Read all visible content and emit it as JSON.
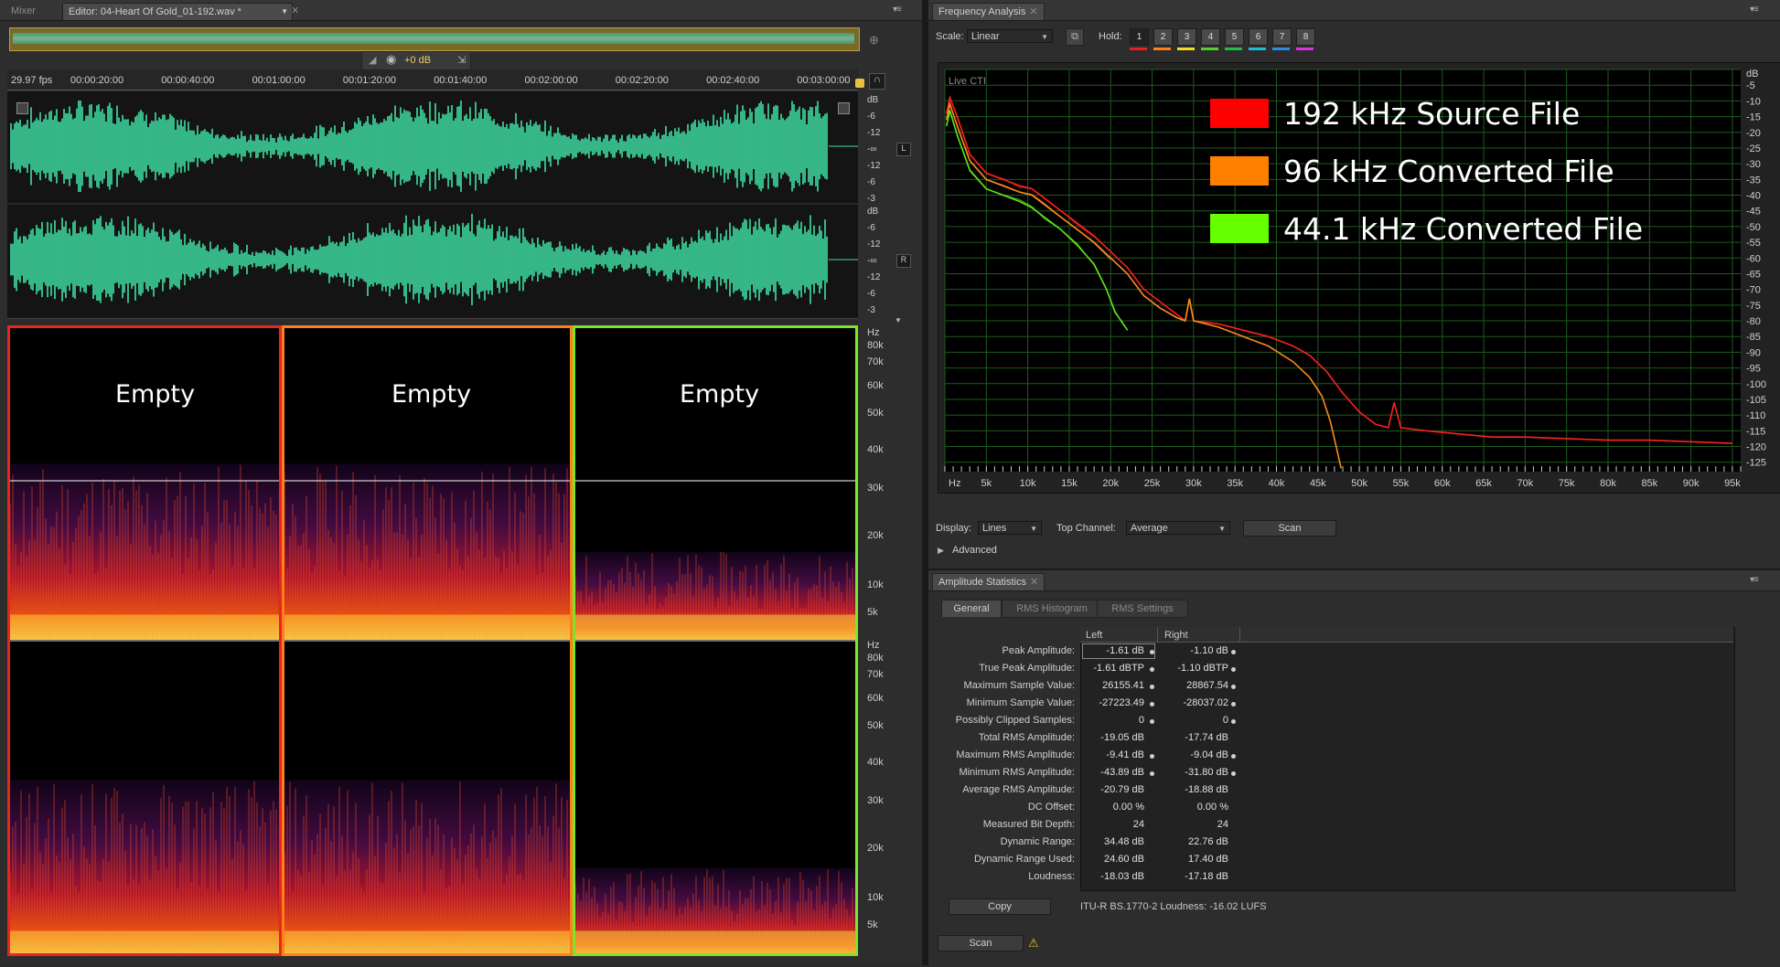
{
  "editor_panel": {
    "tabs": [
      {
        "label": "Mixer",
        "active": false
      },
      {
        "label": "Editor: 04-Heart Of Gold_01-192.wav *",
        "active": true
      }
    ],
    "volume_label": "+0 dB",
    "fps": "29.97 fps",
    "time_ruler": [
      "00:00:20:00",
      "00:00:40:00",
      "00:01:00:00",
      "00:01:20:00",
      "00:01:40:00",
      "00:02:00:00",
      "00:02:20:00",
      "00:02:40:00",
      "00:03:00:00"
    ],
    "db_scale_top": [
      "dB",
      "-6",
      "-12",
      "-∞",
      "-12",
      "-6",
      "-3"
    ],
    "db_scale_bottom": [
      "dB",
      "-6",
      "-12",
      "-∞",
      "-12",
      "-6",
      "-3"
    ],
    "channel_left": "L",
    "channel_right": "R",
    "hz_scale_top": [
      "Hz",
      "80k",
      "70k",
      "60k",
      "50k",
      "40k",
      "30k",
      "20k",
      "10k",
      "5k"
    ],
    "hz_scale_bottom": [
      "Hz",
      "80k",
      "70k",
      "60k",
      "50k",
      "40k",
      "30k",
      "20k",
      "10k",
      "5k"
    ],
    "empty_labels": [
      "Empty",
      "Empty",
      "Empty"
    ],
    "waveform_color": "#3fe0a6",
    "section_colors": [
      "#e8251e",
      "#ff7f1a",
      "#79e62a"
    ]
  },
  "frequency_panel": {
    "tab_label": "Frequency Analysis",
    "scale_label": "Scale:",
    "scale_value": "Linear",
    "hold_label": "Hold:",
    "hold_buttons": [
      "1",
      "2",
      "3",
      "4",
      "5",
      "6",
      "7",
      "8"
    ],
    "hold_colors": [
      "#e82020",
      "#ff7f1a",
      "#f0e020",
      "#4fd22a",
      "#1ec04a",
      "#16c0d8",
      "#2c8ce8",
      "#e030e0"
    ],
    "live_cti": "Live CTI",
    "legend": [
      {
        "label": "192 kHz Source File",
        "color": "#ff0000"
      },
      {
        "label": "96 kHz Converted File",
        "color": "#ff8000"
      },
      {
        "label": "44.1 kHz Converted File",
        "color": "#66ff00"
      }
    ],
    "display_label": "Display:",
    "display_value": "Lines",
    "top_channel_label": "Top Channel:",
    "top_channel_value": "Average",
    "scan_label": "Scan",
    "advanced_label": "Advanced"
  },
  "chart_data": {
    "type": "line",
    "xlabel": "",
    "ylabel": "",
    "x_ticks": [
      "Hz",
      "5k",
      "10k",
      "15k",
      "20k",
      "25k",
      "30k",
      "35k",
      "40k",
      "45k",
      "50k",
      "55k",
      "60k",
      "65k",
      "70k",
      "75k",
      "80k",
      "85k",
      "90k",
      "95k"
    ],
    "y_ticks": [
      "dB",
      "-5",
      "-10",
      "-15",
      "-20",
      "-25",
      "-30",
      "-35",
      "-40",
      "-45",
      "-50",
      "-55",
      "-60",
      "-65",
      "-70",
      "-75",
      "-80",
      "-85",
      "-90",
      "-95",
      "-100",
      "-105",
      "-110",
      "-115",
      "-120",
      "-125"
    ],
    "xlim": [
      0,
      96000
    ],
    "ylim": [
      -128,
      0
    ],
    "grid": true,
    "legend_position": "top-right",
    "series": [
      {
        "name": "192 kHz Source File",
        "color": "#ff2020",
        "x": [
          200,
          600,
          1500,
          3000,
          5000,
          7000,
          9000,
          10500,
          12000,
          14000,
          16000,
          18000,
          20000,
          22000,
          24000,
          26000,
          28000,
          29000,
          29500,
          30000,
          33000,
          36000,
          39000,
          42000,
          44000,
          46000,
          48000,
          50000,
          52000,
          53500,
          54200,
          55000,
          58000,
          62000,
          66000,
          70000,
          75000,
          80000,
          85000,
          90000,
          95000
        ],
        "y": [
          -14,
          -9,
          -15,
          -27,
          -33,
          -35,
          -37,
          -38,
          -41,
          -45,
          -49,
          -53,
          -58,
          -63,
          -70,
          -74,
          -78,
          -80,
          -73,
          -80,
          -81,
          -83,
          -85,
          -88,
          -91,
          -96,
          -103,
          -109,
          -113,
          -114,
          -106,
          -114,
          -115,
          -116,
          -117,
          -117,
          -117.5,
          -118,
          -118,
          -118.5,
          -119
        ]
      },
      {
        "name": "96 kHz Converted File",
        "color": "#ff8a1a",
        "x": [
          200,
          600,
          1500,
          3000,
          5000,
          7000,
          9000,
          10500,
          12000,
          14000,
          16000,
          18000,
          20000,
          22000,
          24000,
          26000,
          28000,
          29000,
          29500,
          30000,
          33000,
          36000,
          39000,
          42000,
          44000,
          45500,
          46500,
          47200,
          47800
        ],
        "y": [
          -16,
          -11,
          -18,
          -29,
          -35,
          -37,
          -39,
          -40,
          -43,
          -47,
          -51,
          -55,
          -60,
          -65,
          -72,
          -76,
          -79,
          -80,
          -73,
          -80,
          -82,
          -85,
          -88,
          -93,
          -98,
          -104,
          -112,
          -120,
          -127
        ]
      },
      {
        "name": "44.1 kHz Converted File",
        "color": "#5ee61e",
        "x": [
          200,
          600,
          1500,
          3000,
          5000,
          7000,
          9000,
          10500,
          12000,
          14000,
          16000,
          18000,
          19500,
          20500,
          21500,
          22050
        ],
        "y": [
          -18,
          -13,
          -21,
          -32,
          -38,
          -40,
          -42,
          -44,
          -47,
          -51,
          -56,
          -62,
          -70,
          -77,
          -81,
          -83
        ]
      }
    ]
  },
  "amplitude_panel": {
    "tab_label": "Amplitude Statistics",
    "subtabs": [
      "General",
      "RMS Histogram",
      "RMS Settings"
    ],
    "column_headers": [
      "Left",
      "Right"
    ],
    "rows": [
      {
        "name": "Peak Amplitude:",
        "left": "-1.61 dB",
        "right": "-1.10 dB",
        "pin": true
      },
      {
        "name": "True Peak Amplitude:",
        "left": "-1.61 dBTP",
        "right": "-1.10 dBTP",
        "pin": true
      },
      {
        "name": "Maximum Sample Value:",
        "left": "26155.41",
        "right": "28867.54",
        "pin": true
      },
      {
        "name": "Minimum Sample Value:",
        "left": "-27223.49",
        "right": "-28037.02",
        "pin": true
      },
      {
        "name": "Possibly Clipped Samples:",
        "left": "0",
        "right": "0",
        "pin": true
      },
      {
        "name": "Total RMS Amplitude:",
        "left": "-19.05 dB",
        "right": "-17.74 dB",
        "pin": false
      },
      {
        "name": "Maximum RMS Amplitude:",
        "left": "-9.41 dB",
        "right": "-9.04 dB",
        "pin": true
      },
      {
        "name": "Minimum RMS Amplitude:",
        "left": "-43.89 dB",
        "right": "-31.80 dB",
        "pin": true
      },
      {
        "name": "Average RMS Amplitude:",
        "left": "-20.79 dB",
        "right": "-18.88 dB",
        "pin": false
      },
      {
        "name": "DC Offset:",
        "left": "0.00 %",
        "right": "0.00 %",
        "pin": false
      },
      {
        "name": "Measured Bit Depth:",
        "left": "24",
        "right": "24",
        "pin": false
      },
      {
        "name": "Dynamic Range:",
        "left": "34.48 dB",
        "right": "22.76 dB",
        "pin": false
      },
      {
        "name": "Dynamic Range Used:",
        "left": "24.60 dB",
        "right": "17.40 dB",
        "pin": false
      },
      {
        "name": "Loudness:",
        "left": "-18.03 dB",
        "right": "-17.18 dB",
        "pin": false
      }
    ],
    "copy_label": "Copy",
    "loudness_text": "ITU-R BS.1770-2 Loudness: -16.02 LUFS",
    "scan_label": "Scan"
  }
}
